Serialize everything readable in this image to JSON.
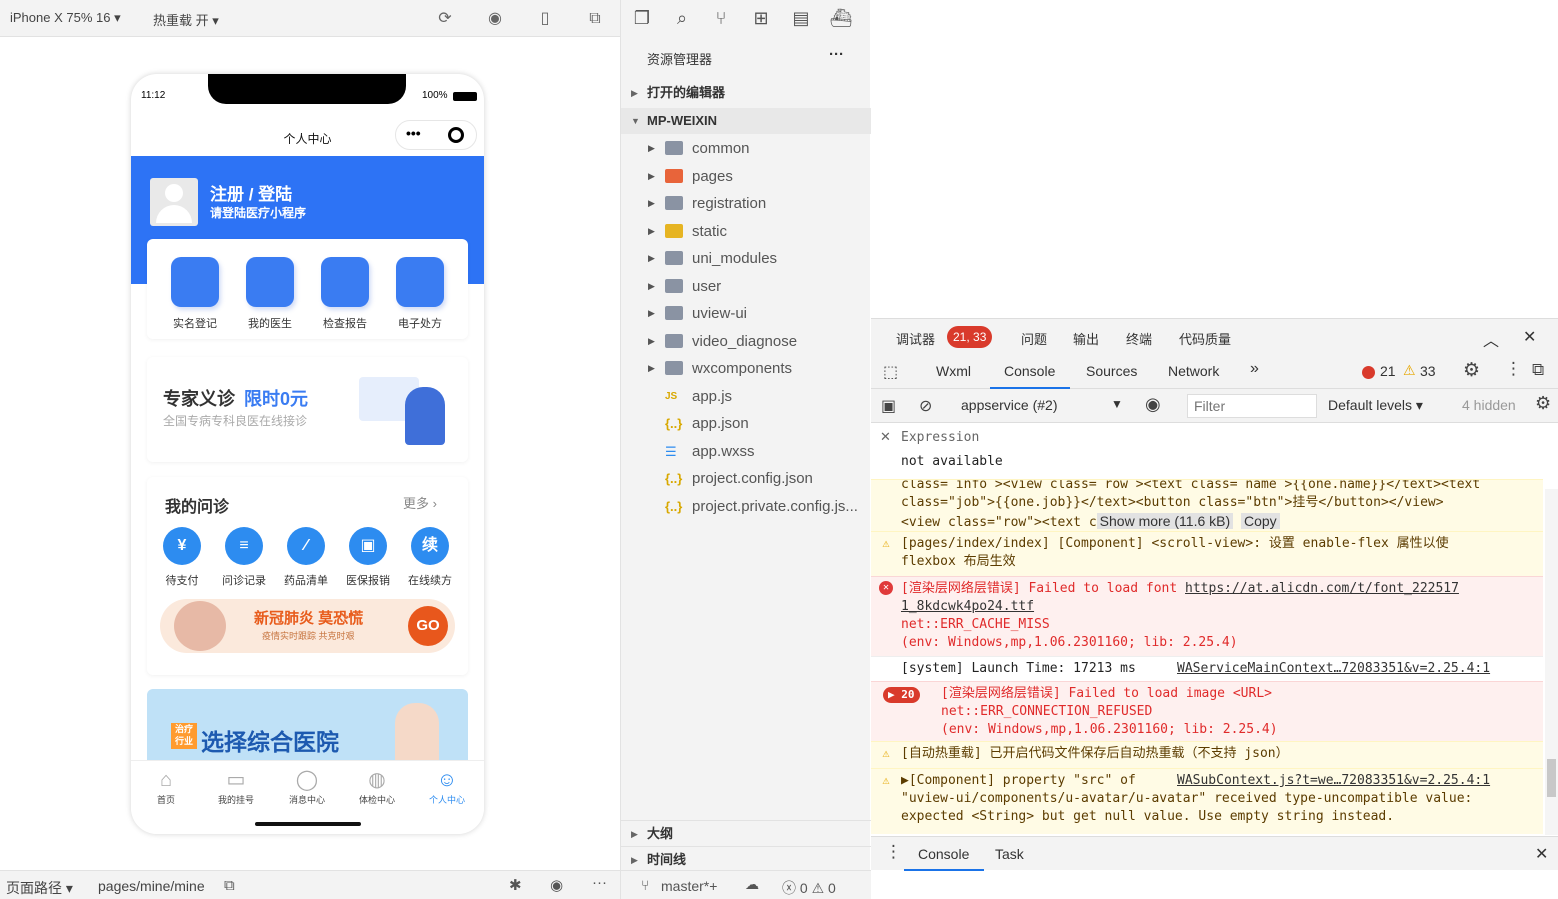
{
  "simulator": {
    "device": "iPhone X 75% 16 ▾",
    "hotreload": "热重载 开 ▾",
    "phone": {
      "time": "11:12",
      "battery": "100%",
      "nav_title": "个人中心",
      "login_title": "注册 / 登陆",
      "login_sub": "请登陆医疗小程序",
      "quick": [
        "实名登记",
        "我的医生",
        "检查报告",
        "电子处方"
      ],
      "promo_title": "专家义诊",
      "promo_highlight": "限时0元",
      "promo_sub": "全国专病专科良医在线接诊",
      "section_title": "我的问诊",
      "section_more": "更多 ›",
      "services": [
        {
          "label": "待支付",
          "glyph": "¥"
        },
        {
          "label": "问诊记录",
          "glyph": "≡"
        },
        {
          "label": "药品清单",
          "glyph": "∕"
        },
        {
          "label": "医保报销",
          "glyph": "▣"
        },
        {
          "label": "在线续方",
          "glyph": "续"
        }
      ],
      "banner_title": "新冠肺炎 莫恐慌",
      "banner_sub": "疫情实时跟踪 共克时艰",
      "banner_go": "GO",
      "hospital_badge": "治疗行业",
      "hospital_title": "选择综合医院",
      "tabs": [
        "首页",
        "我的挂号",
        "消息中心",
        "体检中心",
        "个人中心"
      ]
    },
    "bottom": {
      "path_label": "页面路径 ▾",
      "path": "pages/mine/mine"
    }
  },
  "explorer": {
    "title": "资源管理器",
    "more": "···",
    "open_editors": "打开的编辑器",
    "project": "MP-WEIXIN",
    "folders": [
      "common",
      "pages",
      "registration",
      "static",
      "uni_modules",
      "user",
      "uview-ui",
      "video_diagnose",
      "wxcomponents"
    ],
    "files": [
      {
        "name": "app.js",
        "icon": "JS",
        "color": "#d8a800"
      },
      {
        "name": "app.json",
        "icon": "{..}",
        "color": "#d8a800"
      },
      {
        "name": "app.wxss",
        "icon": "☰",
        "color": "#2d8cf0"
      },
      {
        "name": "project.config.json",
        "icon": "{..}",
        "color": "#d8a800"
      },
      {
        "name": "project.private.config.js...",
        "icon": "{..}",
        "color": "#d8a800"
      }
    ],
    "outline": "大纲",
    "timeline": "时间线",
    "branch": "master*+",
    "status_counts": "ⓧ 0 ⚠ 0"
  },
  "devtools": {
    "tabs_top": [
      "调试器",
      "问题",
      "输出",
      "终端",
      "代码质量"
    ],
    "badge": "21, 33",
    "tabs": [
      "Wxml",
      "Console",
      "Sources",
      "Network",
      "»"
    ],
    "err_count": "21",
    "warn_count": "33",
    "context": "appservice (#2)",
    "filter_placeholder": "Filter",
    "levels": "Default levels ▾",
    "hidden": "4 hidden",
    "expression_label": "Expression",
    "expression_value": "not available",
    "log": {
      "l0a": "class= info ><view class= row ><text class= name >{{one.name}}</text><text",
      "l0b": "class=\"job\">{{one.job}}</text><button class=\"btn\">挂号</button></view>",
      "l0c": "<view class=\"row\"><text c",
      "show_more": "Show more (11.6 kB)",
      "copy": "Copy",
      "l1a": "[pages/index/index] [Component] <scroll-view>: 设置 enable-flex 属性以使",
      "l1b": "flexbox 布局生效",
      "l2a": "[渲染层网络层错误] Failed to load font ",
      "l2link1": "https://at.alicdn.com/t/font_222517",
      "l2link2": "1_8kdcwk4po24.ttf",
      "l2b": "net::ERR_CACHE_MISS",
      "l2c": "(env: Windows,mp,1.06.2301160; lib: 2.25.4)",
      "l3": "[system] Launch Time: 17213 ms",
      "l3link": "WAServiceMainContext…72083351&v=2.25.4:1",
      "l4count": "▶ 20",
      "l4a": "[渲染层网络层错误] Failed to load image <URL>",
      "l4b": "net::ERR_CONNECTION_REFUSED",
      "l4c": "(env: Windows,mp,1.06.2301160; lib: 2.25.4)",
      "l5": "[自动热重载] 已开启代码文件保存后自动热重载（不支持 json）",
      "l6a": "▶[Component] property \"src\" of",
      "l6link": "WASubContext.js?t=we…72083351&v=2.25.4:1",
      "l6b": "\"uview-ui/components/u-avatar/u-avatar\" received type-uncompatible value:",
      "l6c": "expected <String> but get null value. Use empty string instead."
    },
    "drawer_tabs": [
      "Console",
      "Task"
    ]
  }
}
